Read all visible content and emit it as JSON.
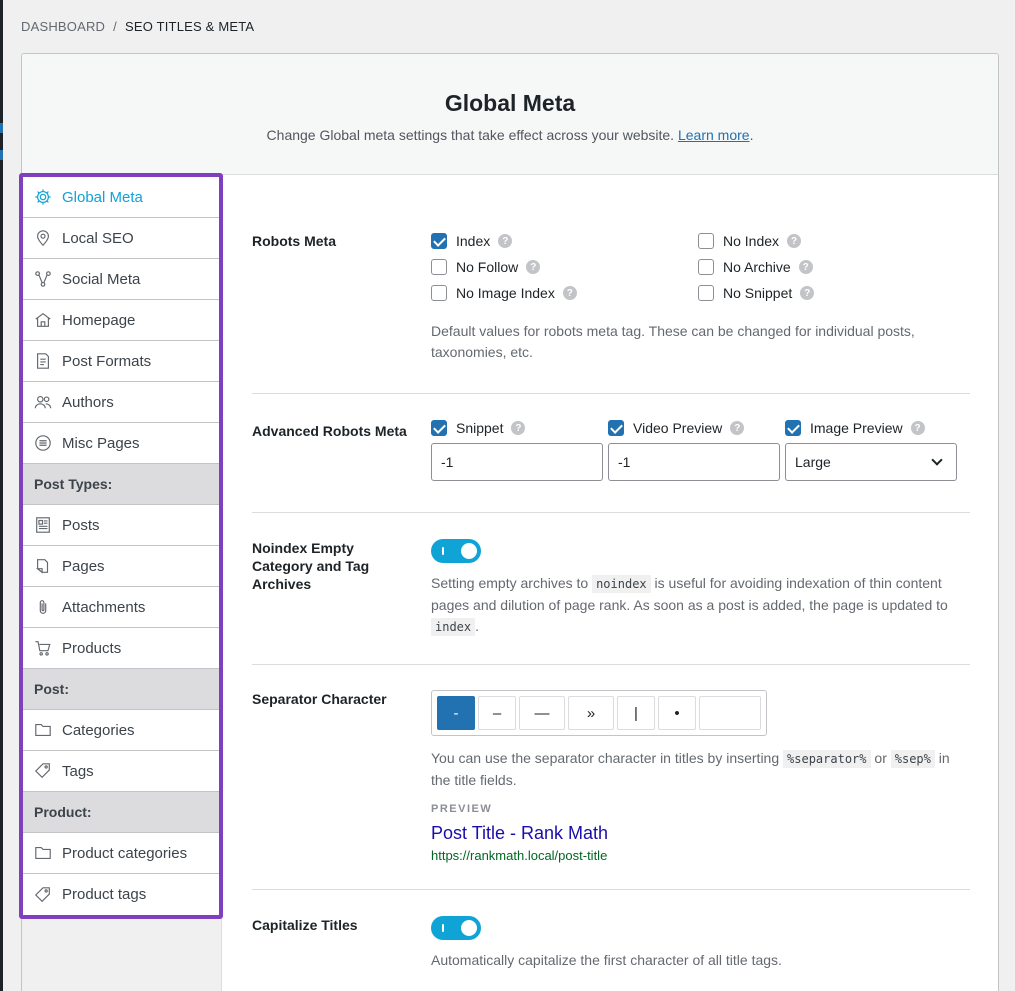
{
  "breadcrumb": {
    "parent": "DASHBOARD",
    "separator": "/",
    "current": "SEO TITLES & META"
  },
  "header": {
    "title": "Global Meta",
    "description": "Change Global meta settings that take effect across your website.",
    "learn_more": "Learn more",
    "period": "."
  },
  "sidebar": {
    "items": [
      {
        "label": "Global Meta",
        "icon": "gear-icon"
      },
      {
        "label": "Local SEO",
        "icon": "location-pin-icon"
      },
      {
        "label": "Social Meta",
        "icon": "share-nodes-icon"
      },
      {
        "label": "Homepage",
        "icon": "home-icon"
      },
      {
        "label": "Post Formats",
        "icon": "document-icon"
      },
      {
        "label": "Authors",
        "icon": "users-icon"
      },
      {
        "label": "Misc Pages",
        "icon": "list-circle-icon"
      }
    ],
    "groups": {
      "post_types": "Post Types:",
      "post": "Post:",
      "product": "Product:"
    },
    "post_type_items": [
      {
        "label": "Posts",
        "icon": "posts-icon"
      },
      {
        "label": "Pages",
        "icon": "pages-icon"
      },
      {
        "label": "Attachments",
        "icon": "paperclip-icon"
      },
      {
        "label": "Products",
        "icon": "cart-icon"
      }
    ],
    "post_items": [
      {
        "label": "Categories",
        "icon": "folder-icon"
      },
      {
        "label": "Tags",
        "icon": "tag-icon"
      }
    ],
    "product_items": [
      {
        "label": "Product categories",
        "icon": "folder-icon"
      },
      {
        "label": "Product tags",
        "icon": "tag-icon"
      }
    ]
  },
  "robots_meta": {
    "label": "Robots Meta",
    "options": [
      {
        "label": "Index",
        "checked": true
      },
      {
        "label": "No Index",
        "checked": false
      },
      {
        "label": "No Follow",
        "checked": false
      },
      {
        "label": "No Archive",
        "checked": false
      },
      {
        "label": "No Image Index",
        "checked": false
      },
      {
        "label": "No Snippet",
        "checked": false
      }
    ],
    "description": "Default values for robots meta tag. These can be changed for individual posts, taxonomies, etc."
  },
  "advanced_robots": {
    "label": "Advanced Robots Meta",
    "snippet": {
      "label": "Snippet",
      "value": "-1"
    },
    "video": {
      "label": "Video Preview",
      "value": "-1"
    },
    "image": {
      "label": "Image Preview",
      "value": "Large"
    }
  },
  "noindex_empty": {
    "label": "Noindex Empty Category and Tag Archives",
    "desc_1": "Setting empty archives to",
    "code_1": "noindex",
    "desc_2": "is useful for avoiding indexation of thin content pages and dilution of page rank. As soon as a post is added, the page is updated to",
    "code_2": "index",
    "desc_3": "."
  },
  "separator": {
    "label": "Separator Character",
    "options": [
      "-",
      "–",
      "—",
      "»",
      "|",
      "•"
    ],
    "desc_1": "You can use the separator character in titles by inserting",
    "code_1": "%separator%",
    "desc_2": "or",
    "code_2": "%sep%",
    "desc_3": "in the title fields.",
    "preview_label": "PREVIEW",
    "preview_title": "Post Title - Rank Math",
    "preview_url": "https://rankmath.local/post-title"
  },
  "capitalize": {
    "label": "Capitalize Titles",
    "description": "Automatically capitalize the first character of all title tags."
  },
  "help_glyph": "?",
  "colors": {
    "accent": "#10a3d6",
    "wp_blue": "#2271b1",
    "highlight": "#7f3fbf"
  }
}
